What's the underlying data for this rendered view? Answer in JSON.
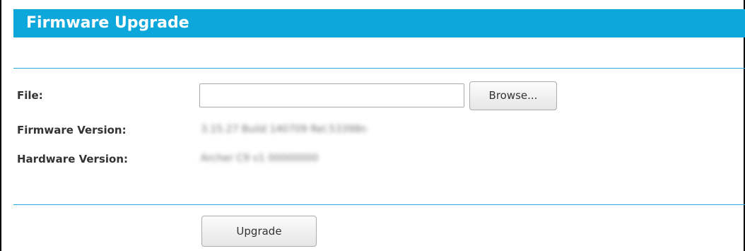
{
  "page": {
    "title": "Firmware Upgrade"
  },
  "form": {
    "file_label": "File:",
    "file_value": "",
    "browse_label": "Browse...",
    "firmware_version_label": "Firmware Version:",
    "firmware_version_value": "3.15.27 Build 140709 Rel.53398n",
    "hardware_version_label": "Hardware Version:",
    "hardware_version_value": "Archer C9 v1 00000000",
    "upgrade_label": "Upgrade"
  },
  "colors": {
    "header_bg": "#0ea7dc",
    "divider": "#29a9dc",
    "header_text": "#ffffff"
  }
}
